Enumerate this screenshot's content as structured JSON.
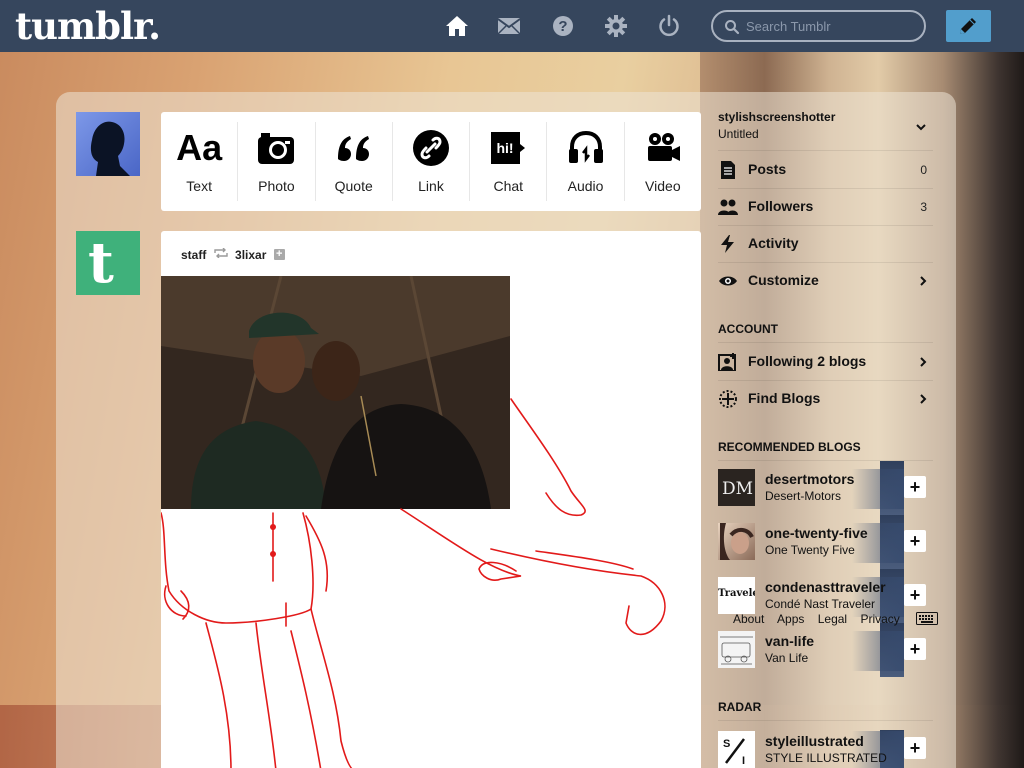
{
  "header": {
    "logo": "tumblr.",
    "search_placeholder": "Search Tumblr",
    "icons": [
      "home-icon",
      "mail-icon",
      "help-icon",
      "settings-icon",
      "power-icon",
      "search-icon",
      "compose-pencil-icon"
    ],
    "bar_color": "#36465d",
    "compose_color": "#529ecc"
  },
  "post_types": [
    {
      "label": "Text",
      "glyph": "Aa",
      "icon": "text-icon"
    },
    {
      "label": "Photo",
      "icon": "camera-icon"
    },
    {
      "label": "Quote",
      "icon": "quote-icon"
    },
    {
      "label": "Link",
      "icon": "link-icon"
    },
    {
      "label": "Chat",
      "icon": "chat-icon",
      "glyph": "hi!"
    },
    {
      "label": "Audio",
      "icon": "headphones-icon"
    },
    {
      "label": "Video",
      "icon": "video-camera-icon"
    }
  ],
  "post": {
    "author": "staff",
    "reblogged_from": "3lixar",
    "follow_glyph": "+"
  },
  "sidebar": {
    "blog_name": "stylishscreenshotter",
    "blog_title": "Untitled",
    "items": [
      {
        "label": "Posts",
        "count": "0",
        "icon": "posts-icon"
      },
      {
        "label": "Followers",
        "count": "3",
        "icon": "followers-icon"
      },
      {
        "label": "Activity",
        "icon": "activity-bolt-icon"
      },
      {
        "label": "Customize",
        "icon": "eye-icon",
        "arrow": true
      }
    ],
    "account_heading": "ACCOUNT",
    "account_items": [
      {
        "label": "Following 2 blogs",
        "icon": "following-icon"
      },
      {
        "label": "Find Blogs",
        "icon": "compass-icon"
      }
    ],
    "recommended_heading": "RECOMMENDED BLOGS",
    "recommended": [
      {
        "name": "desertmotors",
        "title": "Desert-Motors",
        "thumb_text": "DM"
      },
      {
        "name": "one-twenty-five",
        "title": "One Twenty Five"
      },
      {
        "name": "condenasttraveler",
        "title": "Condé Nast Traveler",
        "thumb_text": "Traveler"
      },
      {
        "name": "van-life",
        "title": "Van Life"
      }
    ],
    "add_glyph": "+",
    "footer_links": [
      "About",
      "Apps",
      "Legal",
      "Privacy"
    ],
    "radar_heading": "RADAR",
    "radar": {
      "name": "styleillustrated",
      "title": "STYLE ILLUSTRATED",
      "thumb_text": "S I"
    }
  }
}
